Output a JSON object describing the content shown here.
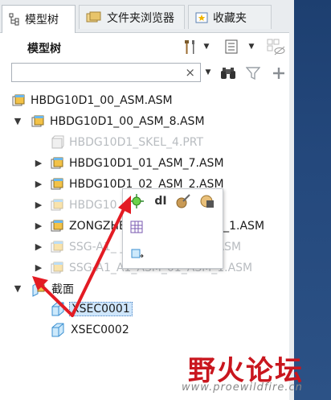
{
  "tabs": [
    {
      "label": "模型树",
      "icon": "model-tree-icon",
      "active": true
    },
    {
      "label": "文件夹浏览器",
      "icon": "folder-browser-icon",
      "active": false
    },
    {
      "label": "收藏夹",
      "icon": "favorites-icon",
      "active": false
    }
  ],
  "panel": {
    "title": "模型树"
  },
  "search": {
    "value": "",
    "placeholder": "",
    "clear_glyph": "×"
  },
  "tree": [
    {
      "label": "HBDG10D1_00_ASM.ASM",
      "level": 0,
      "expander": "",
      "icon": "assembly",
      "dim": false
    },
    {
      "label": "HBDG10D1_00_ASM_8.ASM",
      "level": 1,
      "expander": "▼",
      "icon": "assembly",
      "dim": false
    },
    {
      "label": "HBDG10D1_SKEL_4.PRT",
      "level": 2,
      "expander": "",
      "icon": "part",
      "dim": true
    },
    {
      "label": "HBDG10D1_01_ASM_7.ASM",
      "level": 2,
      "expander": "▶",
      "icon": "assembly",
      "dim": false
    },
    {
      "label": "HBDG10D1_02_ASM_2.ASM",
      "level": 2,
      "expander": "▶",
      "icon": "assembly",
      "dim": false
    },
    {
      "label": "HBDG10",
      "level": 2,
      "expander": "▶",
      "icon": "assembly",
      "dim": true
    },
    {
      "label": "ZONGZHENG_ASM_25_ASM_1.ASM",
      "level": 2,
      "expander": "▶",
      "icon": "assembly",
      "dim": false
    },
    {
      "label": "SSG-A1_  _ASM_01_ASM_1.ASM",
      "level": 2,
      "expander": "▶",
      "icon": "assembly",
      "dim": true
    },
    {
      "label": "SSG-A1_A1_ASM_01_ASM_1.ASM",
      "level": 2,
      "expander": "▶",
      "icon": "assembly",
      "dim": true
    },
    {
      "label": "截面",
      "level": 0,
      "expander": "▼",
      "icon": "sections",
      "dim": false
    },
    {
      "label": "XSEC0001",
      "level": 1,
      "expander": "",
      "icon": "section",
      "dim": false,
      "selected": true
    },
    {
      "label": "XSEC0002",
      "level": 1,
      "expander": "",
      "icon": "section",
      "dim": false
    }
  ],
  "popup": {
    "buttons": [
      "activate-icon",
      "dimension-icon",
      "edit-definition-icon",
      "display-icon",
      "table-icon",
      "insert-icon"
    ],
    "dim_glyph": "dI"
  },
  "watermark": {
    "brand": "野火论坛",
    "url": "www.proewildfire.cn"
  },
  "colors": {
    "accent": "#4aa3e8",
    "arrow": "#e31b23",
    "selection": "#cfe6fb",
    "watermark": "#c9161e"
  }
}
